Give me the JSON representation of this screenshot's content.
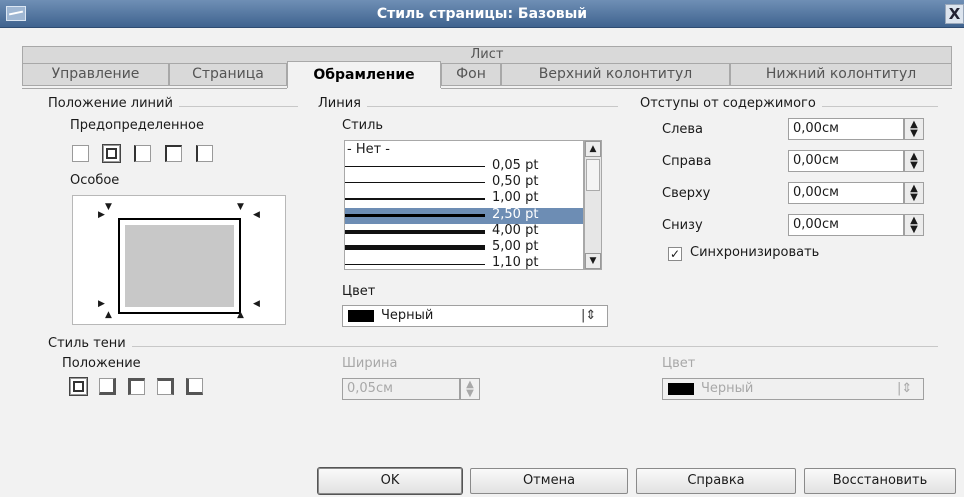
{
  "window": {
    "title": "Стиль страницы: Базовый",
    "close_label": "X"
  },
  "tabs": {
    "top_row": "Лист",
    "items": [
      {
        "label": "Управление"
      },
      {
        "label": "Страница"
      },
      {
        "label": "Обрамление",
        "active": true
      },
      {
        "label": "Фон"
      },
      {
        "label": "Верхний колонтитул"
      },
      {
        "label": "Нижний колонтитул"
      }
    ]
  },
  "line_position": {
    "group_title": "Положение линий",
    "predefined_label": "Предопределенное",
    "custom_label": "Особое"
  },
  "line": {
    "group_title": "Линия",
    "style_label": "Стиль",
    "styles": [
      {
        "label": "- Нет -"
      },
      {
        "label": "0,05 pt"
      },
      {
        "label": "0,50 pt"
      },
      {
        "label": "1,00 pt"
      },
      {
        "label": "2,50 pt",
        "selected": true
      },
      {
        "label": "4,00 pt"
      },
      {
        "label": "5,00 pt"
      },
      {
        "label": "1,10 pt"
      }
    ],
    "color_label": "Цвет",
    "color_value": "Черный"
  },
  "spacing": {
    "group_title": "Отступы от содержимого",
    "left_label": "Слева",
    "left_value": "0,00см",
    "right_label": "Справа",
    "right_value": "0,00см",
    "top_label": "Сверху",
    "top_value": "0,00см",
    "bottom_label": "Снизу",
    "bottom_value": "0,00см",
    "sync_label": "Синхронизировать",
    "sync_checked": true
  },
  "shadow": {
    "group_title": "Стиль тени",
    "position_label": "Положение",
    "width_label": "Ширина",
    "width_value": "0,05см",
    "color_label": "Цвет",
    "color_value": "Черный"
  },
  "buttons": {
    "ok": "OK",
    "cancel": "Отмена",
    "help": "Справка",
    "reset": "Восстановить"
  },
  "colors": {
    "title_bar": "#4a6e99",
    "selection": "#6d8db4",
    "swatch": "#000000"
  }
}
